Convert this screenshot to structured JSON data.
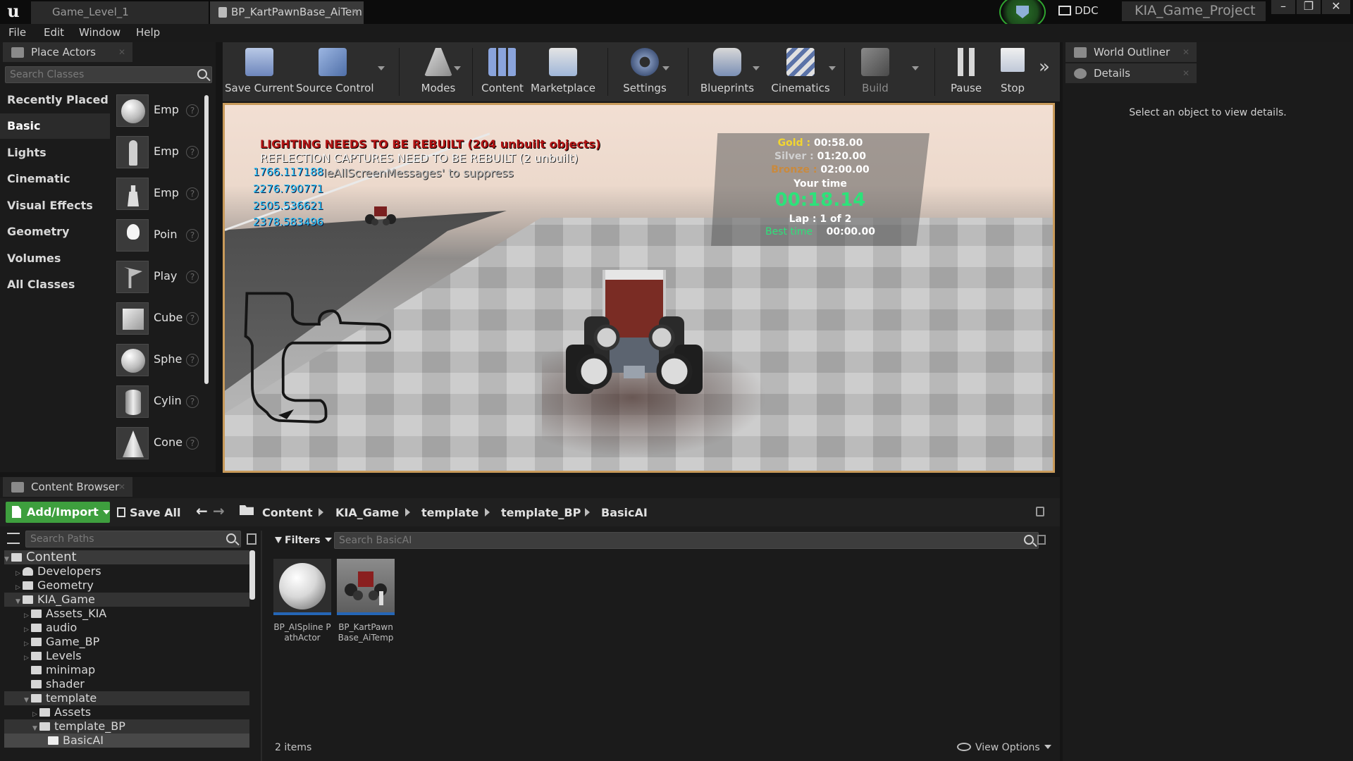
{
  "title_bar": {
    "tabs": [
      "Game_Level_1",
      "BP_KartPawnBase_AiTem"
    ],
    "ddc": "DDC",
    "project": "KIA_Game_Project"
  },
  "menu": [
    "File",
    "Edit",
    "Window",
    "Help"
  ],
  "place_actors": {
    "title": "Place Actors",
    "search_placeholder": "Search Classes",
    "categories": [
      "Recently Placed",
      "Basic",
      "Lights",
      "Cinematic",
      "Visual Effects",
      "Geometry",
      "Volumes",
      "All Classes"
    ],
    "active_category": "Basic",
    "items": [
      "Emp",
      "Emp",
      "Emp",
      "Poin",
      "Play",
      "Cube",
      "Sphe",
      "Cylin",
      "Cone"
    ]
  },
  "toolbar": {
    "buttons": [
      "Save Current",
      "Source Control",
      "Modes",
      "Content",
      "Marketplace",
      "Settings",
      "Blueprints",
      "Cinematics",
      "Build",
      "Pause",
      "Stop"
    ]
  },
  "viewport": {
    "messages": {
      "lighting": "LIGHTING NEEDS TO BE REBUILT (204 unbuilt objects)",
      "reflection": "REFLECTION CAPTURES NEED TO BE REBUILT (2 unbuilt)",
      "suppress": "leAllScreenMessages' to suppress"
    },
    "numbers": [
      "1766.117188",
      "2276.790771",
      "2505.536621",
      "2378.583496"
    ],
    "race": {
      "gold_label": "Gold",
      "gold_time": "00:58.00",
      "silver_label": "Silver",
      "silver_time": "01:20.00",
      "bronze_label": "Bronze",
      "bronze_time": "02:00.00",
      "your_time_label": "Your time",
      "your_time": "00:18.14",
      "lap": "Lap : 1 of 2",
      "best_label": "Best time",
      "best_time": "00:00.00"
    }
  },
  "right_panel": {
    "world_outliner": "World Outliner",
    "details": "Details",
    "details_message": "Select an object to view details."
  },
  "content_browser": {
    "title": "Content Browser",
    "add_import": "Add/Import",
    "save_all": "Save All",
    "breadcrumb": [
      "Content",
      "KIA_Game",
      "template",
      "template_BP",
      "BasicAI"
    ],
    "search_paths_placeholder": "Search Paths",
    "filters": "Filters",
    "search_assets_placeholder": "Search BasicAI",
    "tree": [
      {
        "label": "Content"
      },
      {
        "label": "Developers"
      },
      {
        "label": "Geometry"
      },
      {
        "label": "KIA_Game"
      },
      {
        "label": "Assets_KIA"
      },
      {
        "label": "audio"
      },
      {
        "label": "Game_BP"
      },
      {
        "label": "Levels"
      },
      {
        "label": "minimap"
      },
      {
        "label": "shader"
      },
      {
        "label": "template"
      },
      {
        "label": "Assets"
      },
      {
        "label": "template_BP"
      },
      {
        "label": "BasicAI"
      }
    ],
    "assets": [
      "BP_AISpline PathActor",
      "BP_KartPawn Base_AiTemp"
    ],
    "item_count": "2 items",
    "view_options": "View Options"
  },
  "colors": {
    "accent_green": "#3e9f3e",
    "viewport_border": "#c89a5a",
    "debug_red": "#b01414",
    "debug_cyan": "#27c5ff",
    "timer_green": "#2de27a",
    "gold": "#f2d530"
  }
}
